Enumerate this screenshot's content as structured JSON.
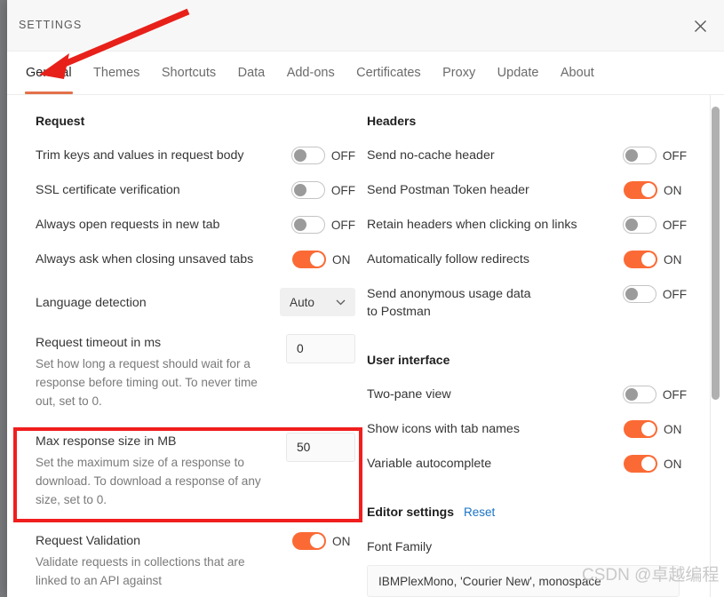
{
  "window": {
    "title": "SETTINGS",
    "close_icon": "close-icon"
  },
  "tabs": [
    {
      "label": "General",
      "active": true
    },
    {
      "label": "Themes",
      "active": false
    },
    {
      "label": "Shortcuts",
      "active": false
    },
    {
      "label": "Data",
      "active": false
    },
    {
      "label": "Add-ons",
      "active": false
    },
    {
      "label": "Certificates",
      "active": false
    },
    {
      "label": "Proxy",
      "active": false
    },
    {
      "label": "Update",
      "active": false
    },
    {
      "label": "About",
      "active": false
    }
  ],
  "left_column": {
    "section_title": "Request",
    "rows": [
      {
        "label": "Trim keys and values in request body",
        "control": "toggle",
        "state": "OFF"
      },
      {
        "label": "SSL certificate verification",
        "control": "toggle",
        "state": "OFF"
      },
      {
        "label": "Always open requests in new tab",
        "control": "toggle",
        "state": "OFF"
      },
      {
        "label": "Always ask when closing unsaved tabs",
        "control": "toggle",
        "state": "ON"
      },
      {
        "label": "Language detection",
        "control": "select",
        "value": "Auto"
      },
      {
        "label": "Request timeout in ms",
        "desc": "Set how long a request should wait for a response before timing out. To never time out, set to 0.",
        "control": "input",
        "value": "0"
      },
      {
        "label": "Max response size in MB",
        "desc": "Set the maximum size of a response to download. To download a response of any size, set to 0.",
        "control": "input",
        "value": "50"
      },
      {
        "label": "Request Validation",
        "desc": "Validate requests in collections that are linked to an API against",
        "control": "toggle",
        "state": "ON"
      }
    ]
  },
  "right_column": {
    "headers_section": {
      "title": "Headers",
      "rows": [
        {
          "label": "Send no-cache header",
          "state": "OFF"
        },
        {
          "label": "Send Postman Token header",
          "state": "ON"
        },
        {
          "label": "Retain headers when clicking on links",
          "state": "OFF"
        },
        {
          "label": "Automatically follow redirects",
          "state": "ON"
        },
        {
          "label": "Send anonymous usage data to Postman",
          "state": "OFF"
        }
      ]
    },
    "ui_section": {
      "title": "User interface",
      "rows": [
        {
          "label": "Two-pane view",
          "state": "OFF"
        },
        {
          "label": "Show icons with tab names",
          "state": "ON"
        },
        {
          "label": "Variable autocomplete",
          "state": "ON"
        }
      ]
    },
    "editor_section": {
      "title": "Editor settings",
      "reset_label": "Reset",
      "font_family_label": "Font Family",
      "font_family_value": "IBMPlexMono, 'Courier New', monospace"
    }
  },
  "annotations": {
    "watermark": "CSDN @卓越编程",
    "arrow_color": "#e8201a",
    "highlight_color": "#f01e1e"
  },
  "colors": {
    "accent_orange": "#fb6a35",
    "tab_underline": "#e3714a",
    "link_blue": "#1a73c7"
  }
}
